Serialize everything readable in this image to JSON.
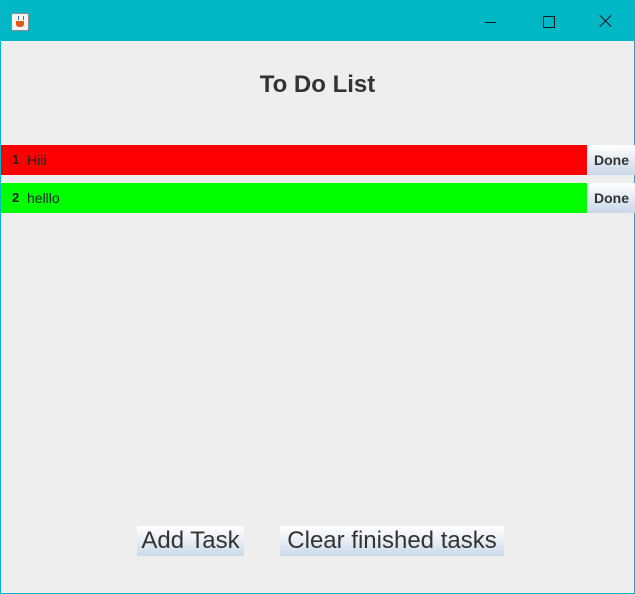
{
  "window": {
    "app_icon": "java-cup-icon",
    "controls": {
      "minimize_icon": "minimize-icon",
      "maximize_icon": "maximize-icon",
      "close_icon": "close-icon"
    }
  },
  "header": {
    "title": "To Do List"
  },
  "tasks": [
    {
      "number": "1",
      "text": "Hiii",
      "status_color": "#ff0000",
      "button_label": "Done"
    },
    {
      "number": "2",
      "text": "helllo",
      "status_color": "#00ff00",
      "button_label": "Done"
    }
  ],
  "footer": {
    "add_label": "Add Task",
    "clear_label": "Clear finished tasks"
  },
  "colors": {
    "titlebar": "#00b7c6",
    "background": "#eeeeee"
  }
}
